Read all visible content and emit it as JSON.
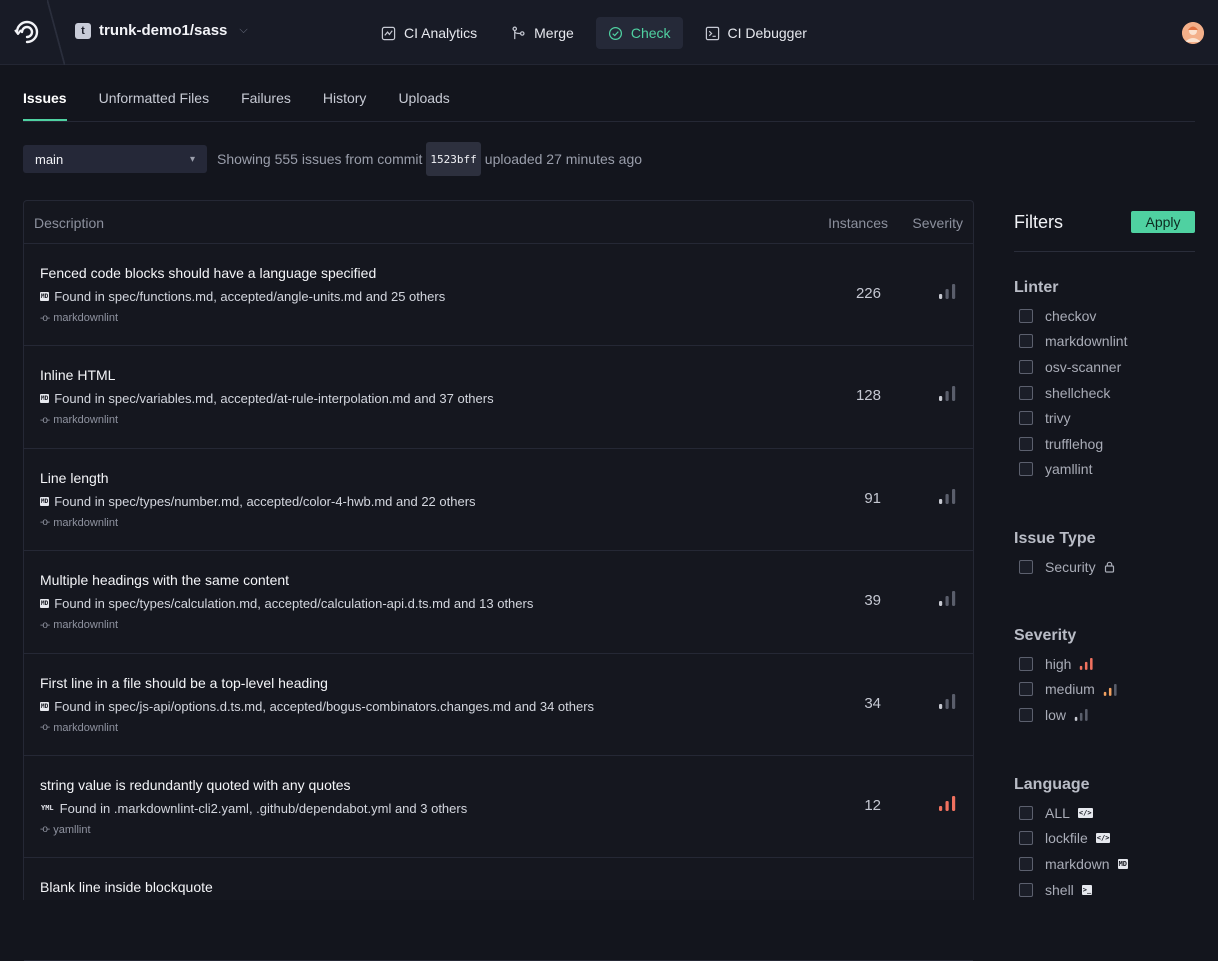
{
  "header": {
    "repo_badge": "t",
    "repo_name": "trunk-demo1/sass",
    "nav": [
      {
        "label": "CI Analytics",
        "icon": "analytics-icon"
      },
      {
        "label": "Merge",
        "icon": "merge-icon"
      },
      {
        "label": "Check",
        "icon": "check-circle-icon",
        "active": true
      },
      {
        "label": "CI Debugger",
        "icon": "terminal-icon"
      }
    ]
  },
  "tabs": [
    {
      "label": "Issues",
      "active": true
    },
    {
      "label": "Unformatted Files"
    },
    {
      "label": "Failures"
    },
    {
      "label": "History"
    },
    {
      "label": "Uploads"
    }
  ],
  "branch": {
    "value": "main"
  },
  "summary": {
    "before": "Showing 555 issues from commit",
    "commit": "1523bff",
    "after": "uploaded 27 minutes ago"
  },
  "table": {
    "headers": {
      "description": "Description",
      "instances": "Instances",
      "severity": "Severity"
    },
    "rows": [
      {
        "title": "Fenced code blocks should have a language specified",
        "files": "Found in spec/functions.md, accepted/angle-units.md and 25 others",
        "file_icon": "MD",
        "linter": "markdownlint",
        "instances": "226",
        "severity": "low"
      },
      {
        "title": "Inline HTML",
        "files": "Found in spec/variables.md, accepted/at-rule-interpolation.md and 37 others",
        "file_icon": "MD",
        "linter": "markdownlint",
        "instances": "128",
        "severity": "low"
      },
      {
        "title": "Line length",
        "files": "Found in spec/types/number.md, accepted/color-4-hwb.md and 22 others",
        "file_icon": "MD",
        "linter": "markdownlint",
        "instances": "91",
        "severity": "low"
      },
      {
        "title": "Multiple headings with the same content",
        "files": "Found in spec/types/calculation.md, accepted/calculation-api.d.ts.md and 13 others",
        "file_icon": "MD",
        "linter": "markdownlint",
        "instances": "39",
        "severity": "low"
      },
      {
        "title": "First line in a file should be a top-level heading",
        "files": "Found in spec/js-api/options.d.ts.md, accepted/bogus-combinators.changes.md and 34 others",
        "file_icon": "MD",
        "linter": "markdownlint",
        "instances": "34",
        "severity": "low"
      },
      {
        "title": "string value is redundantly quoted with any quotes",
        "files": "Found in .markdownlint-cli2.yaml, .github/dependabot.yml and 3 others",
        "file_icon": "YML",
        "linter": "yamllint",
        "instances": "12",
        "severity": "high"
      },
      {
        "title": "Blank line inside blockquote",
        "files": "",
        "file_icon": "",
        "linter": "",
        "instances": "",
        "severity": ""
      }
    ]
  },
  "filters": {
    "title": "Filters",
    "apply_label": "Apply",
    "linter": {
      "title": "Linter",
      "items": [
        "checkov",
        "markdownlint",
        "osv-scanner",
        "shellcheck",
        "trivy",
        "trufflehog",
        "yamllint"
      ]
    },
    "issue_type": {
      "title": "Issue Type",
      "items": [
        "Security"
      ]
    },
    "severity": {
      "title": "Severity",
      "items": [
        "high",
        "medium",
        "low"
      ]
    },
    "language": {
      "title": "Language",
      "items": [
        "ALL",
        "lockfile",
        "markdown",
        "shell"
      ]
    }
  },
  "colors": {
    "accent": "#4fd1a1",
    "severity_high": "#f0715f",
    "severity_medium": "#f0a060",
    "severity_low": "#c8cad2"
  }
}
